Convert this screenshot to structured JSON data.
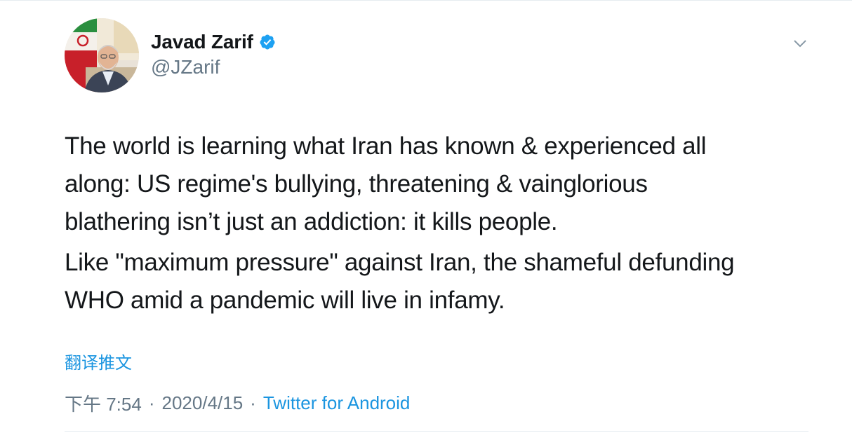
{
  "author": {
    "name": "Javad Zarif",
    "handle": "@JZarif",
    "verified": true,
    "avatar_icon": "profile-photo"
  },
  "tweet": {
    "paragraphs": [
      "The world is learning what Iran has known & experienced all\nalong: US regime's bullying, threatening & vainglorious\nblathering isn’t just an addiction: it kills people.",
      "Like \"maximum pressure\" against Iran, the shameful defunding\nWHO amid a pandemic will live in infamy."
    ]
  },
  "translate_label": "翻译推文",
  "meta": {
    "time": "下午 7:54",
    "separator": "·",
    "date": "2020/4/15",
    "source": "Twitter for Android"
  },
  "colors": {
    "text": "#14171a",
    "secondary": "#657786",
    "link": "#1b95e0",
    "border": "#e6ecf0"
  }
}
